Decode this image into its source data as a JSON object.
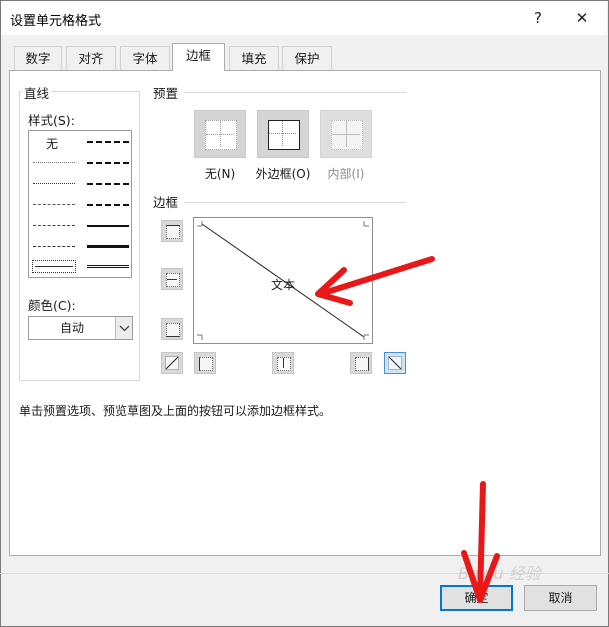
{
  "window": {
    "title": "设置单元格格式",
    "help_glyph": "?",
    "close_glyph": "✕"
  },
  "tabs": [
    {
      "label": "数字"
    },
    {
      "label": "对齐"
    },
    {
      "label": "字体"
    },
    {
      "label": "边框",
      "active": true
    },
    {
      "label": "填充"
    },
    {
      "label": "保护"
    }
  ],
  "line": {
    "group_label": "直线",
    "style_label": "样式(S):",
    "style_none": "无",
    "color_label": "颜色(C):",
    "color_value": "自动"
  },
  "presets": {
    "group_label": "预置",
    "none": "无(N)",
    "outline": "外边框(O)",
    "inside": "内部(I)"
  },
  "border": {
    "group_label": "边框",
    "preview_text": "文本"
  },
  "hint": "单击预置选项、预览草图及上面的按钮可以添加边框样式。",
  "buttons": {
    "ok": "确定",
    "cancel": "取消"
  },
  "watermark": "Baidu 经验",
  "colors": {
    "annotation_arrow": "#e81818",
    "focus_blue": "#0078d7"
  }
}
